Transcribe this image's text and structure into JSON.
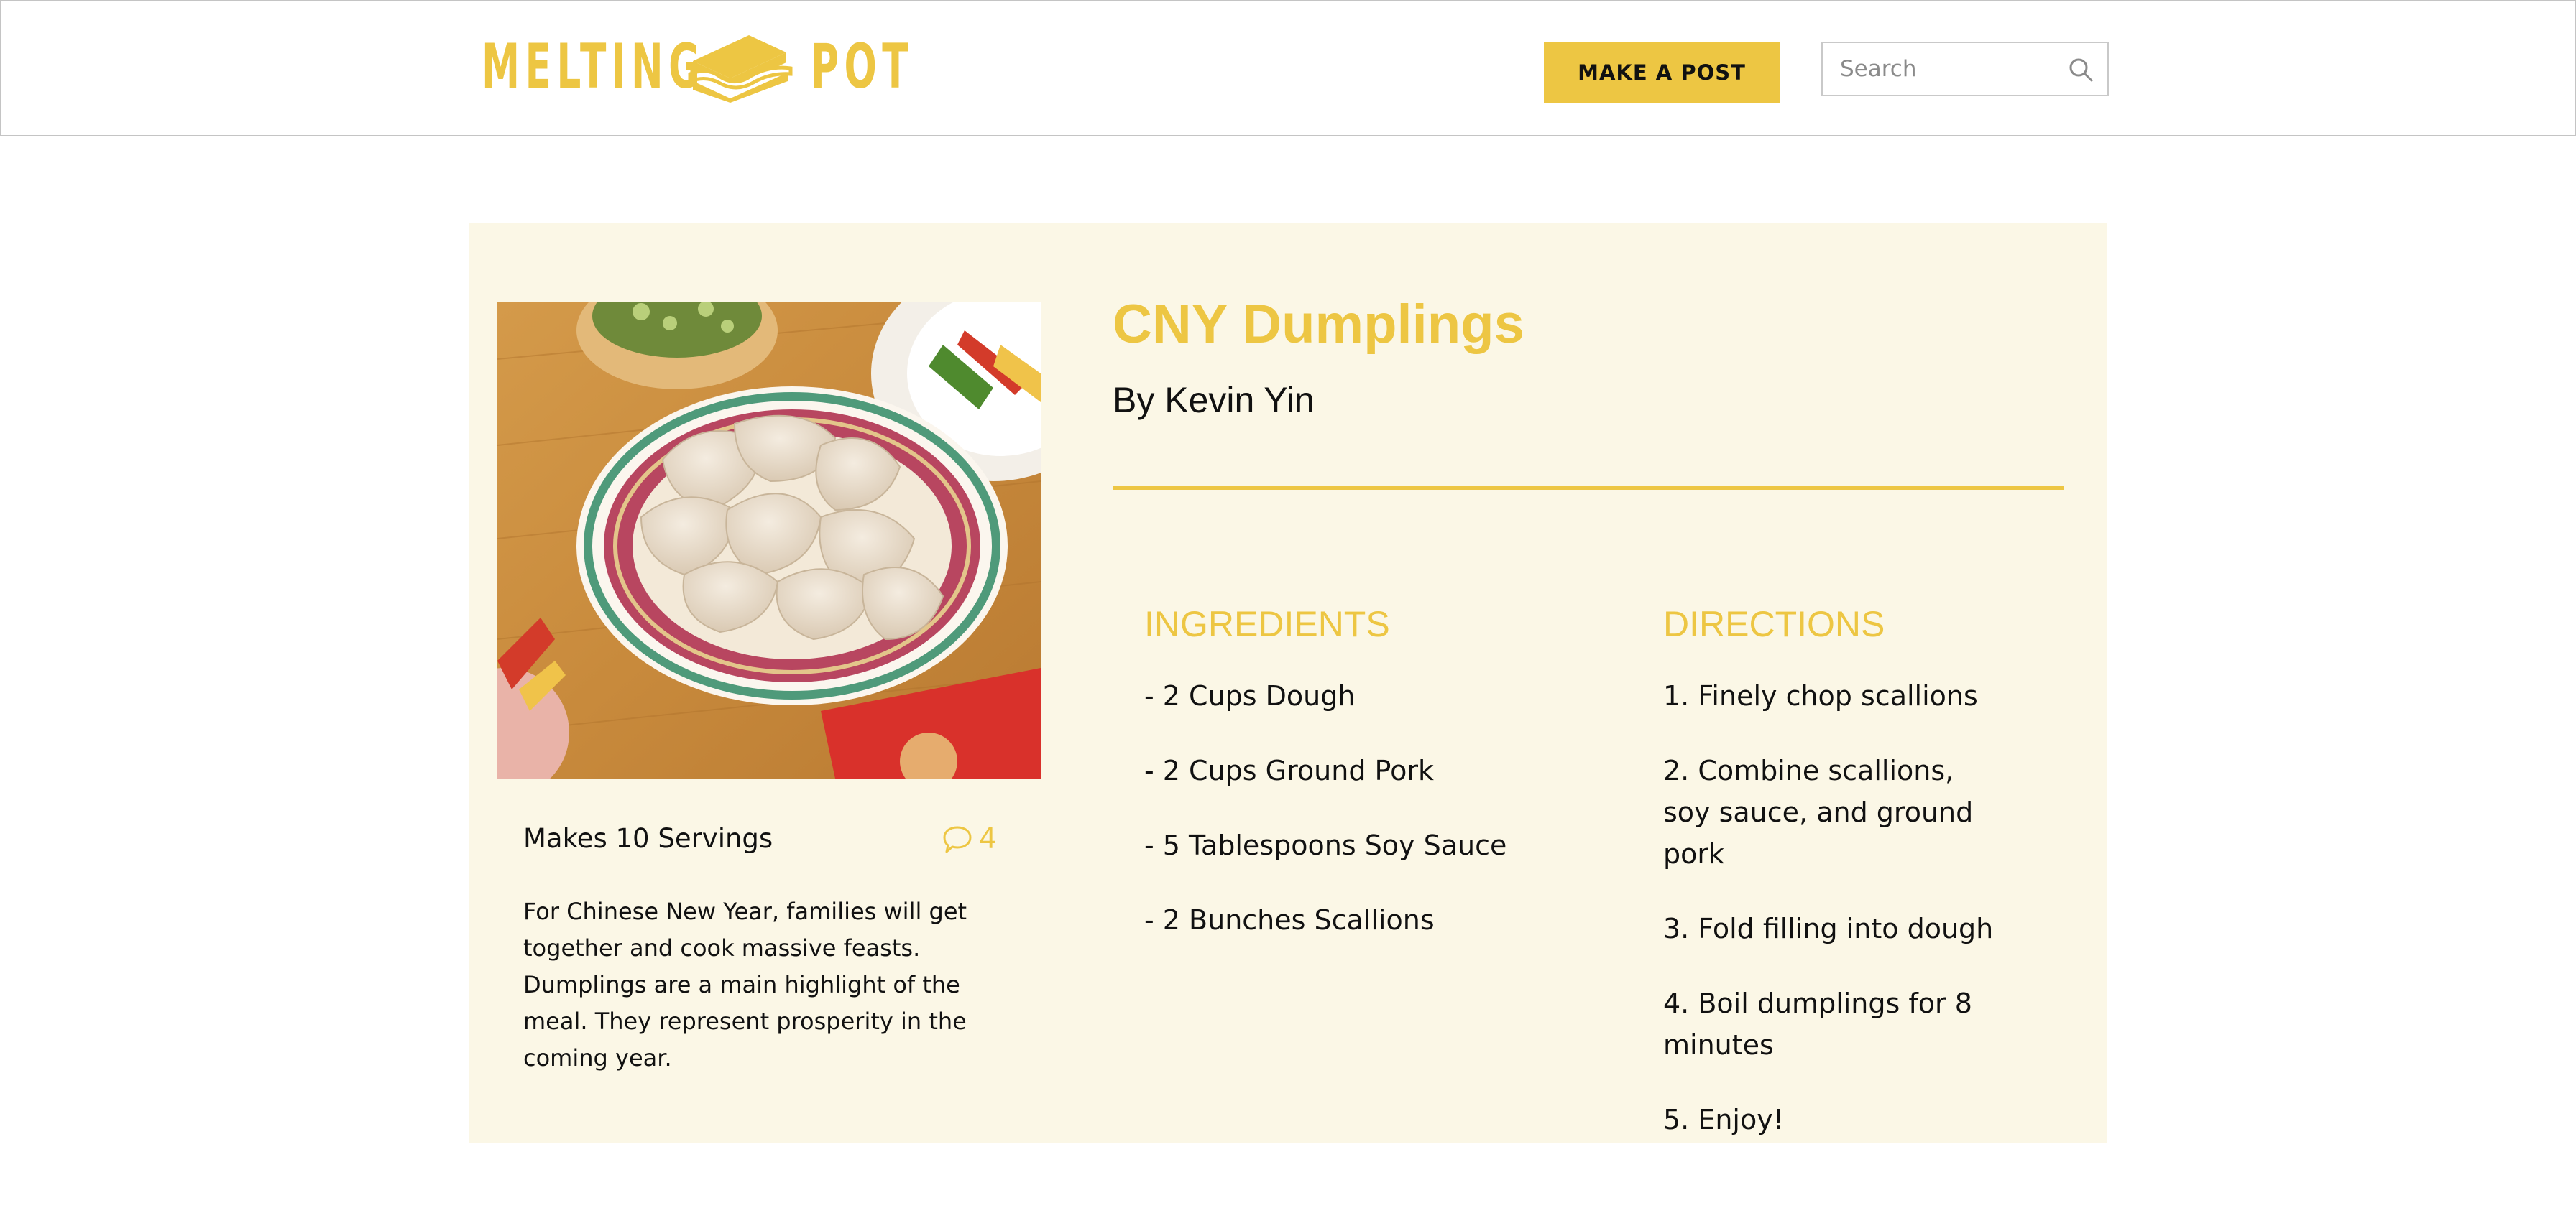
{
  "header": {
    "logo_left": "MELTING",
    "logo_right": "POT",
    "logo_icon": "sandwich-icon",
    "make_post_label": "MAKE A POST",
    "search_placeholder": "Search",
    "search_icon": "search-icon",
    "accent_color": "#EDC643"
  },
  "recipe": {
    "title": "CNY Dumplings",
    "author": "By Kevin Yin",
    "image": "dumplings-photo",
    "servings": "Makes 10 Servings",
    "comment_icon": "comment-bubble-icon",
    "comment_count": "4",
    "description": "For Chinese New Year, families will get together and cook massive feasts. Dumplings are a main highlight of the meal. They represent prosperity in the coming year.",
    "ingredients_heading": "INGREDIENTS",
    "ingredients": [
      "- 2 Cups Dough",
      "- 2 Cups Ground Pork",
      "- 5 Tablespoons Soy Sauce",
      "- 2 Bunches Scallions"
    ],
    "directions_heading": "DIRECTIONS",
    "directions": [
      "1. Finely chop scallions",
      "2. Combine scallions, soy sauce, and ground pork",
      "3. Fold filling into dough",
      "4. Boil dumplings for 8 minutes",
      "5. Enjoy!"
    ],
    "card_background": "#FBF7E6"
  }
}
